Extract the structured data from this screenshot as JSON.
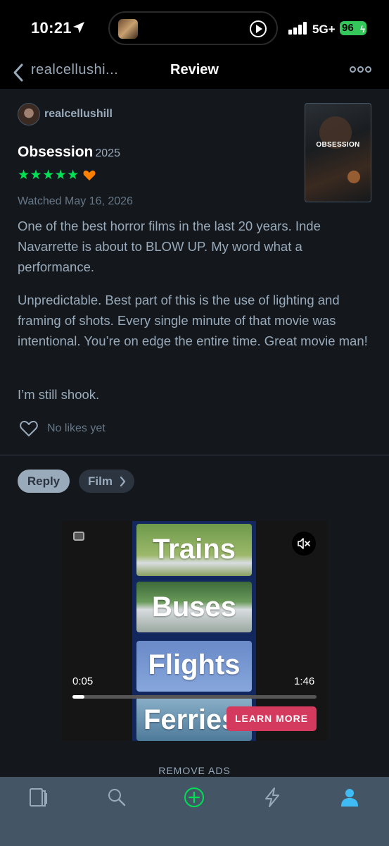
{
  "status_bar": {
    "time": "10:21",
    "network": "5G+",
    "battery": "96"
  },
  "nav": {
    "back_label": "realcellushi...",
    "title": "Review"
  },
  "review": {
    "username": "realcellushill",
    "film_title": "Obsession",
    "film_year": "2025",
    "poster_title": "OBSESSION",
    "rating_stars": "★★★★★",
    "rating_value": 5,
    "liked": true,
    "watched": "Watched May 16, 2026",
    "paragraphs": [
      "One of the best horror films in the last 20 years. Inde Navarrette is about to BLOW UP. My word what a performance.",
      "Unpredictable. Best part of this is the use of lighting and framing of shots. Every single minute of that movie was intentional. You’re on edge the entire time. Great movie man!",
      "I’m still shook."
    ],
    "likes_text": "No likes yet"
  },
  "actions": {
    "reply_label": "Reply",
    "film_label": "Film"
  },
  "ad": {
    "tiles": [
      "Trains",
      "Buses",
      "Flights",
      "Ferries"
    ],
    "time_current": "0:05",
    "time_total": "1:46",
    "progress": 0.05,
    "cta_label": "LEARN MORE"
  },
  "remove_ads_label": "REMOVE ADS",
  "tabbar": {
    "tabs": [
      "films-icon",
      "search-icon",
      "add-icon",
      "activity-icon",
      "profile-icon"
    ]
  },
  "colors": {
    "background": "#14181c",
    "star_green": "#00e054",
    "heart_orange": "#ff8000",
    "accent_blue": "#40bcf4",
    "cta_red": "#d43a5e"
  }
}
